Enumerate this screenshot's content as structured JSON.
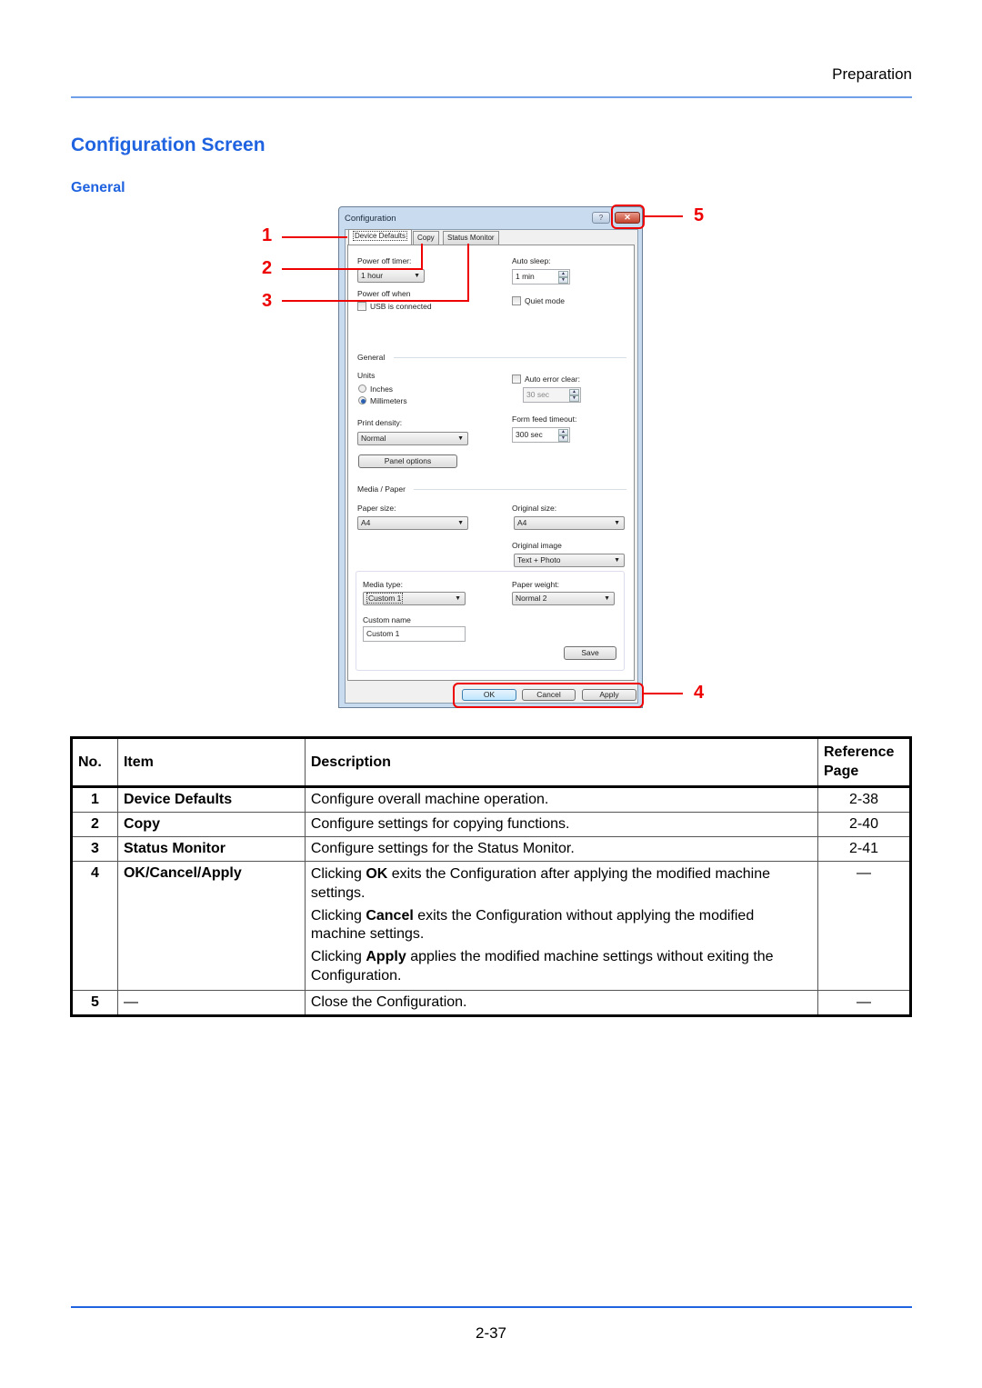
{
  "header": {
    "section": "Preparation"
  },
  "page_title": "Configuration Screen",
  "subsection_title": "General",
  "callouts": [
    "1",
    "2",
    "3",
    "4",
    "5"
  ],
  "dialog": {
    "title": "Configuration",
    "help_icon": "?",
    "close_icon": "✕",
    "tabs": [
      {
        "label": "Device Defaults",
        "active": true
      },
      {
        "label": "Copy",
        "active": false
      },
      {
        "label": "Status Monitor",
        "active": false
      }
    ],
    "power_off_timer": {
      "label": "Power off timer:",
      "value": "1 hour"
    },
    "power_off_when": {
      "label": "Power off when",
      "checkbox_label": "USB is connected",
      "checked": false
    },
    "auto_sleep": {
      "label": "Auto sleep:",
      "value": "1 min"
    },
    "quiet_mode": {
      "label": "Quiet mode",
      "checked": false
    },
    "general_group": "General",
    "units": {
      "label": "Units",
      "options": [
        "Inches",
        "Millimeters"
      ],
      "selected": "Millimeters"
    },
    "auto_error_clear": {
      "label": "Auto error clear:",
      "checked": false,
      "value": "30 sec"
    },
    "print_density": {
      "label": "Print density:",
      "value": "Normal"
    },
    "form_feed_timeout": {
      "label": "Form feed timeout:",
      "value": "300 sec"
    },
    "panel_options_button": "Panel options",
    "media_group": "Media / Paper",
    "paper_size": {
      "label": "Paper size:",
      "value": "A4"
    },
    "original_size": {
      "label": "Original size:",
      "value": "A4"
    },
    "original_image": {
      "label": "Original image",
      "value": "Text + Photo"
    },
    "media_type": {
      "label": "Media type:",
      "value": "Custom 1"
    },
    "paper_weight": {
      "label": "Paper weight:",
      "value": "Normal 2"
    },
    "custom_name": {
      "label": "Custom name",
      "value": "Custom 1"
    },
    "save_button": "Save",
    "ok_button": "OK",
    "cancel_button": "Cancel",
    "apply_button": "Apply"
  },
  "table": {
    "headers": {
      "no": "No.",
      "item": "Item",
      "description": "Description",
      "reference": "Reference Page"
    },
    "rows": [
      {
        "no": "1",
        "item": "Device Defaults",
        "description": [
          "Configure overall machine operation."
        ],
        "ref": "2-38"
      },
      {
        "no": "2",
        "item": "Copy",
        "description": [
          "Configure settings for copying functions."
        ],
        "ref": "2-40"
      },
      {
        "no": "3",
        "item": "Status Monitor",
        "description": [
          "Configure settings for the Status Monitor."
        ],
        "ref": "2-41"
      },
      {
        "no": "4",
        "item": "OK/Cancel/Apply",
        "description_rich": [
          {
            "pre": "Clicking ",
            "bold": "OK",
            "post": " exits the Configuration after applying the modified machine settings."
          },
          {
            "pre": "Clicking ",
            "bold": "Cancel",
            "post": " exits the Configuration without applying the modified machine settings."
          },
          {
            "pre": "Clicking ",
            "bold": "Apply",
            "post": " applies the modified machine settings without exiting the Configuration."
          }
        ],
        "ref": "—"
      },
      {
        "no": "5",
        "item": "—",
        "description": [
          "Close the Configuration."
        ],
        "ref": "—"
      }
    ]
  },
  "footer": {
    "page_number": "2-37"
  }
}
